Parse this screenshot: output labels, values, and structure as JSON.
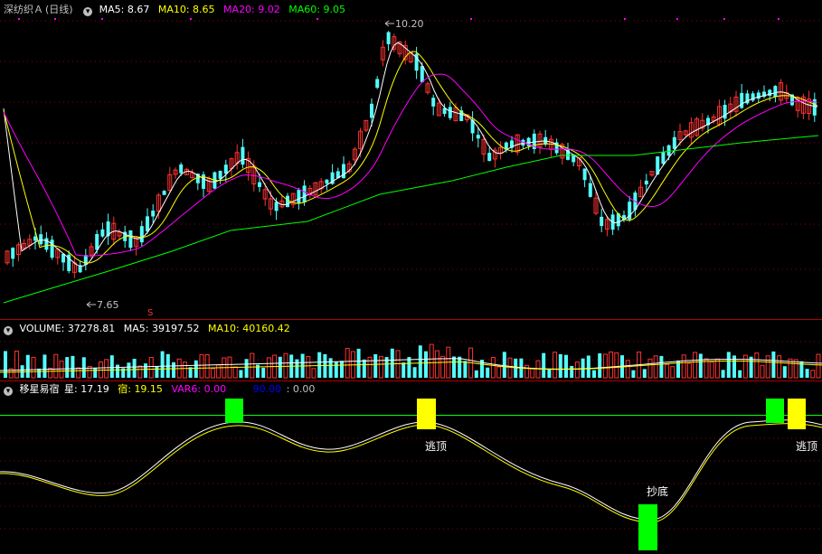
{
  "stock": {
    "name": "深纺织Ａ",
    "period": "(日线)"
  },
  "price_panel": {
    "ma": [
      {
        "label": "MA5:",
        "value": "8.67",
        "color": "#ffffff"
      },
      {
        "label": "MA10:",
        "value": "8.65",
        "color": "#ffff00"
      },
      {
        "label": "MA20:",
        "value": "9.02",
        "color": "#ff00ff"
      },
      {
        "label": "MA60:",
        "value": "9.05",
        "color": "#00ff00"
      }
    ],
    "high_label": "10.20",
    "low_label": "7.65",
    "marker_label": "S"
  },
  "volume_panel": {
    "title": "VOLUME:",
    "value": "37278.81",
    "ma5_label": "MA5:",
    "ma5_value": "39197.52",
    "ma10_label": "MA10:",
    "ma10_value": "40160.42"
  },
  "indicator_panel": {
    "name": "移星易宿",
    "items": [
      {
        "label": "星:",
        "value": "17.19",
        "color": "#ffffff"
      },
      {
        "label": "宿:",
        "value": "19.15",
        "color": "#ffff00"
      },
      {
        "label": "VAR6:",
        "value": "0.00",
        "color": "#ff00ff"
      },
      {
        "label": "",
        "value": "90.00",
        "color": "#0000ff"
      },
      {
        "label": ":",
        "value": "0.00",
        "color": "#c0c0c0"
      }
    ],
    "signals": {
      "escape_top": "逃顶",
      "bottom_fish": "抄底"
    }
  },
  "colors": {
    "up": "#ff3232",
    "down": "#54fcfc",
    "grid": "#8b0000"
  }
}
